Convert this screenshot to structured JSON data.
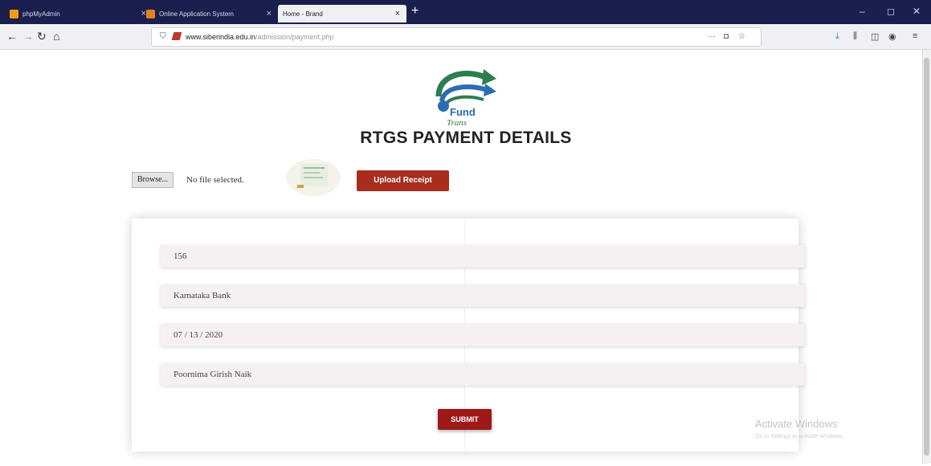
{
  "browser": {
    "tabs": [
      {
        "label": "phpMyAdmin",
        "close": "×",
        "active": false
      },
      {
        "label": "Online Application System",
        "close": "×",
        "active": false
      },
      {
        "label": "Home - Brand",
        "close": "×",
        "active": true
      }
    ],
    "new_tab": "+",
    "window_controls": {
      "minimize": "–",
      "maximize": "◻",
      "close": "✕"
    },
    "nav": {
      "back": "←",
      "forward": "→",
      "reload": "↻",
      "home": "⌂"
    },
    "url_host": "www.siberindia.edu.in",
    "url_path": "/admission/payment.php",
    "url_actions": {
      "more": "···",
      "pocket": "◘",
      "bookmark": "☆"
    },
    "toolbar": {
      "downloads": "⤓",
      "library": "⫼",
      "sidebar": "◫",
      "account": "◉",
      "menu": "≡"
    }
  },
  "page": {
    "logo": {
      "fund_text": "Fund",
      "trans_text": "Trans"
    },
    "title": "RTGS PAYMENT DETAILS",
    "upload": {
      "browse_label": "Browse...",
      "file_status": "No file selected.",
      "upload_button": "Upload Receipt"
    },
    "form": {
      "fields": [
        {
          "value": "156"
        },
        {
          "value": "Karnataka Bank"
        },
        {
          "value": "07 / 13 / 2020"
        },
        {
          "value": "Poornima Girish Naik"
        }
      ],
      "submit_label": "SUBMIT"
    },
    "watermark": {
      "title": "Activate Windows",
      "subtitle": "Go to Settings to activate Windows."
    }
  },
  "colors": {
    "titlebar": "#1b1f4e",
    "upload_button": "#a82d1d",
    "submit_button": "#9e1818",
    "field_bg": "#f5f0f1",
    "logo_green": "#2e7d4f",
    "logo_blue": "#2a6db3"
  }
}
